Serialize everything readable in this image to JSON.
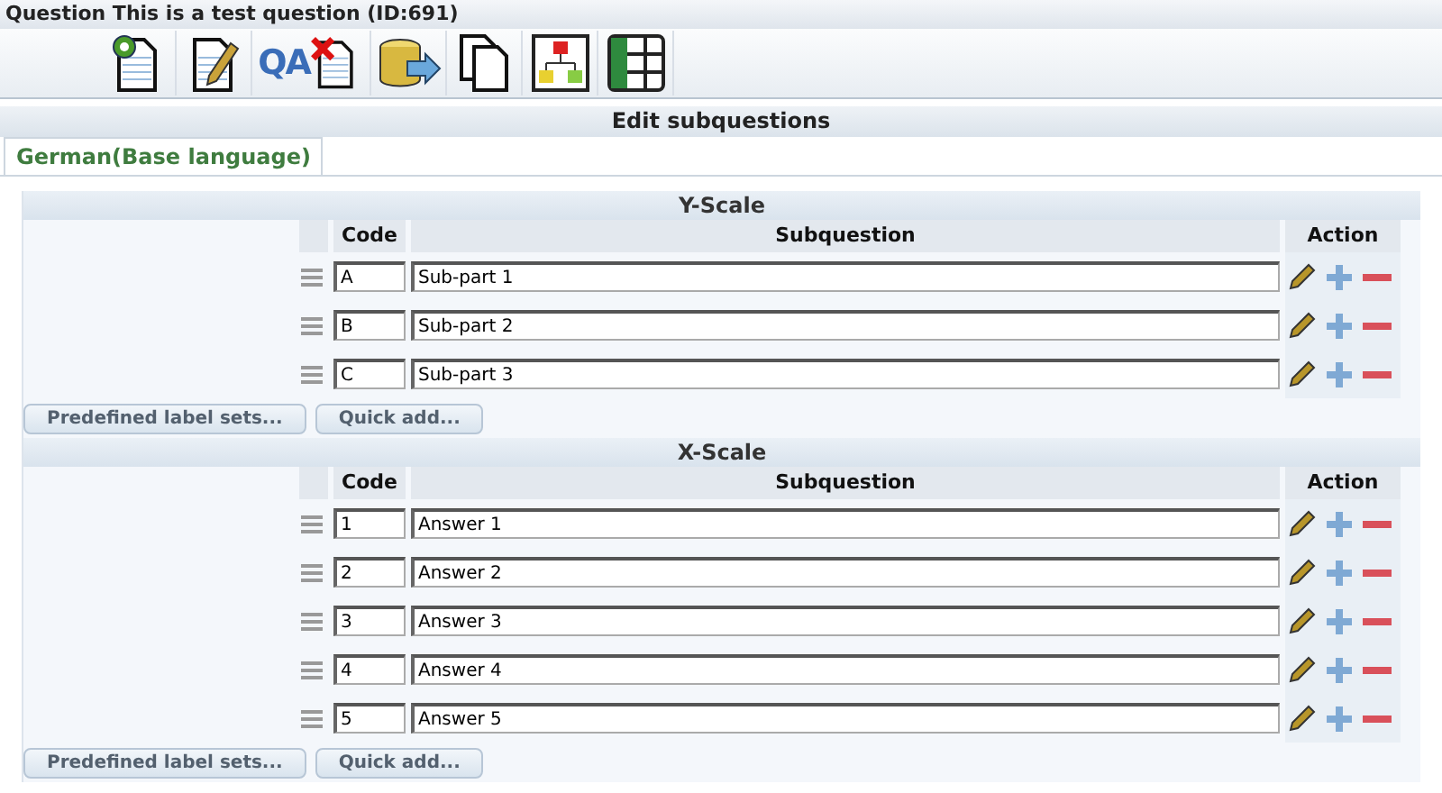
{
  "window": {
    "title": "Question This is a test question (ID:691)"
  },
  "toolbar": [
    {
      "kind": "settings"
    },
    {
      "kind": "edit"
    },
    {
      "kind": "delete",
      "label": "QA"
    },
    {
      "kind": "export"
    },
    {
      "kind": "copy"
    },
    {
      "kind": "conditions"
    },
    {
      "kind": "grid"
    }
  ],
  "heading": "Edit subquestions",
  "tabs": [
    {
      "label": "German(Base language)",
      "selected": true
    }
  ],
  "scales": [
    {
      "title": "Y-Scale",
      "columns": [
        "Code",
        "Subquestion",
        "Action"
      ],
      "rows": [
        {
          "code": "A",
          "text": "Sub-part 1"
        },
        {
          "code": "B",
          "text": "Sub-part 2"
        },
        {
          "code": "C",
          "text": "Sub-part 3"
        }
      ],
      "buttons": [
        "Predefined label sets...",
        "Quick add..."
      ]
    },
    {
      "title": "X-Scale",
      "columns": [
        "Code",
        "Subquestion",
        "Action"
      ],
      "rows": [
        {
          "code": "1",
          "text": "Answer 1"
        },
        {
          "code": "2",
          "text": "Answer 2"
        },
        {
          "code": "3",
          "text": "Answer 3"
        },
        {
          "code": "4",
          "text": "Answer 4"
        },
        {
          "code": "5",
          "text": "Answer 5"
        }
      ],
      "buttons": [
        "Predefined label sets...",
        "Quick add..."
      ]
    }
  ]
}
